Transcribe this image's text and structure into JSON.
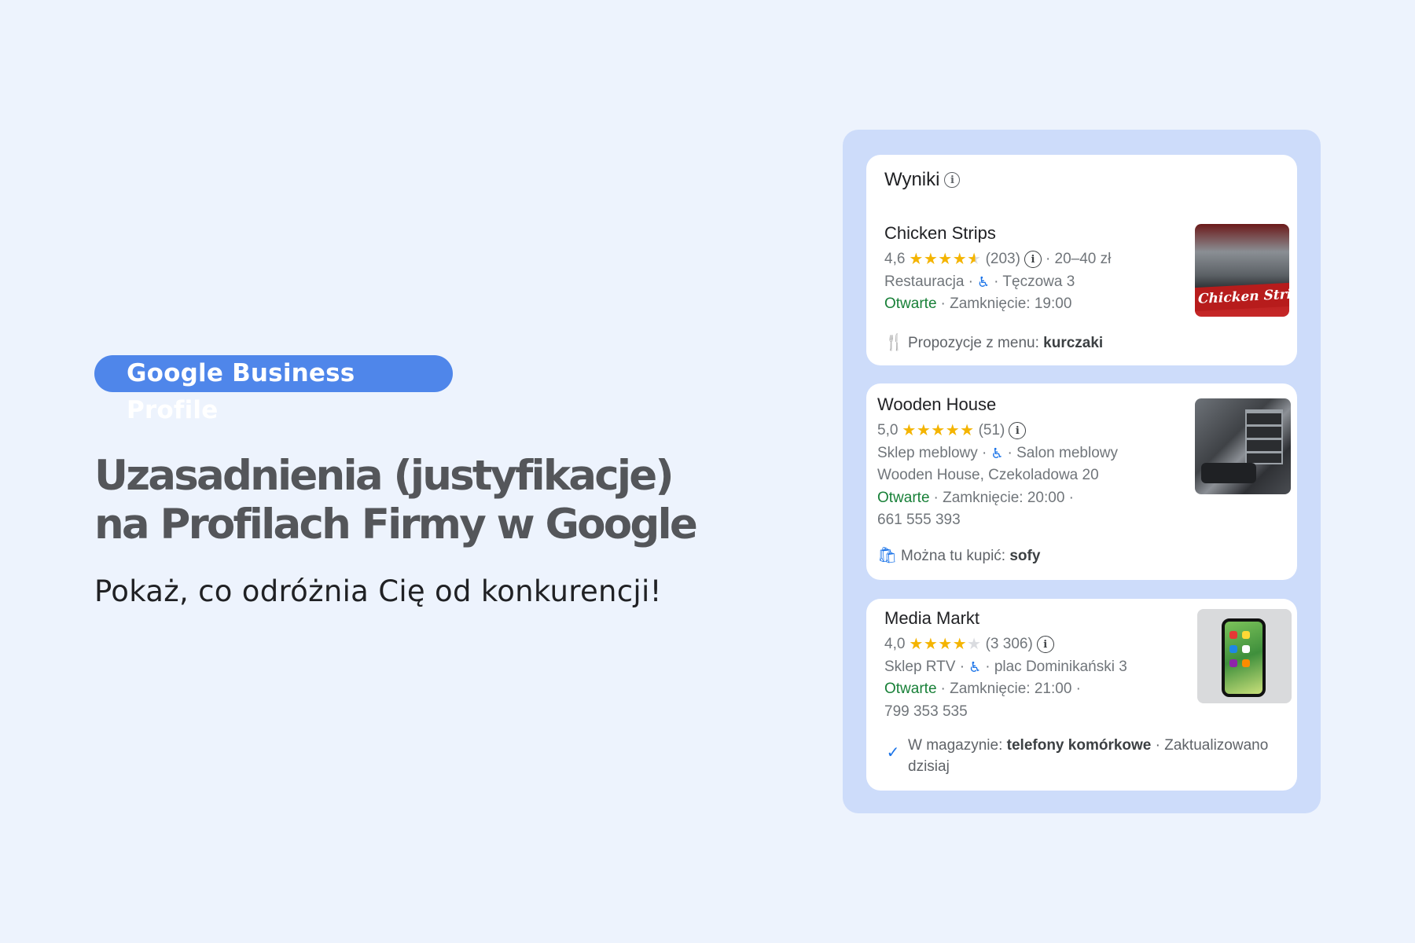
{
  "hero": {
    "badge": "Google Business Profile",
    "headline_line1": "Uzasadnienia (justyfikacje)",
    "headline_line2": "na Profilach Firmy w Google",
    "subline": "Pokaż, co odróżnia Cię od konkurencji!"
  },
  "results": {
    "title": "Wyniki",
    "items": [
      {
        "name": "Chicken Strips",
        "rating": "4,6",
        "rating_value": 4.6,
        "reviews": "(203)",
        "price": "· 20–40 zł",
        "category": "Restauracja ·",
        "address": "· Tęczowa 3",
        "status": "Otwarte",
        "hours": "· Zamknięcie: 19:00",
        "extra_label": "Propozycje z menu:",
        "extra_value": "kurczaki",
        "extra_icon": "fork-knife-icon",
        "image_sign": "Chicken Strips"
      },
      {
        "name": "Wooden House",
        "rating": "5,0",
        "rating_value": 5.0,
        "reviews": "(51)",
        "category": "Sklep meblowy ·",
        "type2": "· Salon meblowy",
        "address": "Wooden House, Czekoladowa 20",
        "status": "Otwarte",
        "hours": "· Zamknięcie: 20:00 ·",
        "phone": "661 555 393",
        "extra_label": "Można tu kupić:",
        "extra_value": "sofy",
        "extra_icon": "shopping-bag-icon"
      },
      {
        "name": "Media Markt",
        "rating": "4,0",
        "rating_value": 4.0,
        "reviews": "(3 306)",
        "category": "Sklep RTV ·",
        "address": "· plac Dominikański 3",
        "status": "Otwarte",
        "hours": "· Zamknięcie: 21:00 ·",
        "phone": "799 353 535",
        "extra_label": "W magazynie:",
        "extra_value": "telefony komórkowe",
        "extra_suffix": "· Zaktualizowano",
        "extra_suffix2": "dzisiaj",
        "extra_icon": "check-circle-icon"
      }
    ]
  },
  "colors": {
    "background": "#edf3fd",
    "badge": "#4f86ea",
    "panel": "#cddcfa",
    "open": "#188038",
    "star": "#f4b400",
    "accent": "#1a73e8"
  }
}
